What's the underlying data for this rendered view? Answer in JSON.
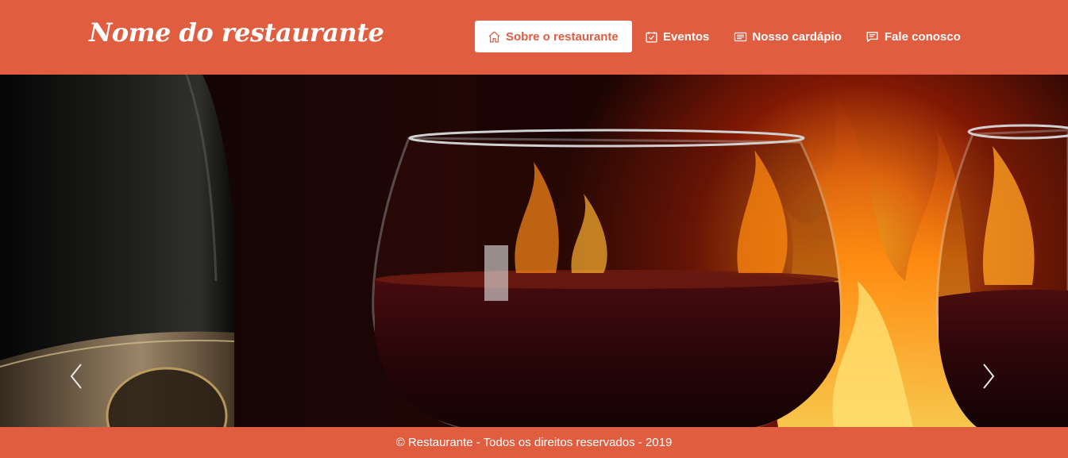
{
  "header": {
    "brand": "Nome do restaurante",
    "nav": [
      {
        "label": "Sobre o restaurante",
        "icon": "home-icon",
        "active": true
      },
      {
        "label": "Eventos",
        "icon": "calendar-check-icon",
        "active": false
      },
      {
        "label": "Nosso cardápio",
        "icon": "menu-list-icon",
        "active": false
      },
      {
        "label": "Fale conosco",
        "icon": "chat-icon",
        "active": false
      }
    ]
  },
  "carousel": {
    "image": "wine-glasses-fireplace-image",
    "prev_icon": "chevron-left-icon",
    "next_icon": "chevron-right-icon"
  },
  "footer": {
    "text": "© Restaurante - Todos os direitos reservados - 2019"
  },
  "colors": {
    "brand": "#e05d40",
    "text_light": "#ffffff"
  }
}
